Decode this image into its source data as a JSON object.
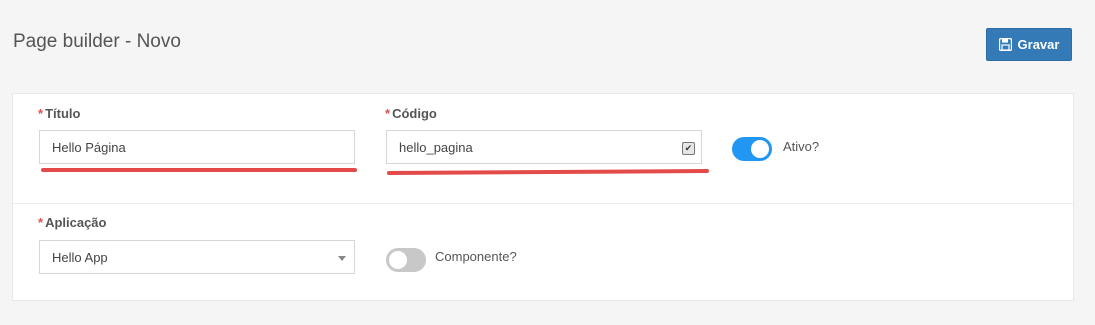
{
  "header": {
    "title": "Page builder - Novo",
    "save_label": "Gravar"
  },
  "form": {
    "titulo": {
      "label": "Título",
      "value": "Hello Página",
      "required": "*"
    },
    "codigo": {
      "label": "Código",
      "value": "hello_pagina",
      "required": "*",
      "autofill_checked": "✔"
    },
    "ativo": {
      "label": "Ativo?",
      "checked": true
    },
    "aplicacao": {
      "label": "Aplicação",
      "value": "Hello App",
      "required": "*"
    },
    "componente": {
      "label": "Componente?",
      "checked": false
    }
  },
  "colors": {
    "primary": "#337ab7",
    "toggle_on": "#2196f3",
    "toggle_off": "#c8c8c8",
    "annotation_underline": "#e34a4a",
    "required": "#d9534f"
  },
  "icons": {
    "save": "floppy-disk-icon",
    "dropdown": "caret-down-icon"
  }
}
